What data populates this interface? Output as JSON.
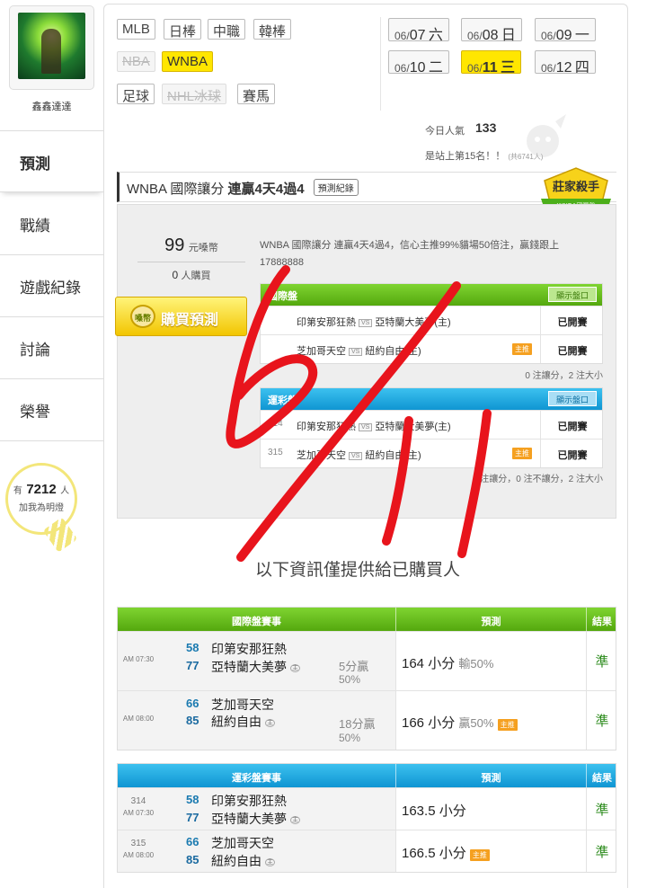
{
  "user": {
    "name": "鑫鑫達達"
  },
  "sidebar": {
    "tabs": [
      {
        "label": "預測",
        "active": true
      },
      {
        "label": "戰績"
      },
      {
        "label": "遊戲紀錄"
      },
      {
        "label": "討論"
      },
      {
        "label": "榮譽"
      }
    ],
    "fans": {
      "prefix": "有",
      "count": "7212",
      "suffix": "人",
      "sub": "加我為明燈"
    }
  },
  "leagues": [
    {
      "label": "MLB",
      "state": "normal"
    },
    {
      "label": "日棒",
      "state": "normal"
    },
    {
      "label": "中職",
      "state": "normal"
    },
    {
      "label": "韓棒",
      "state": "normal"
    },
    {
      "label": "NBA",
      "state": "disabled"
    },
    {
      "label": "WNBA",
      "state": "active"
    },
    {
      "label": "足球",
      "state": "normal"
    },
    {
      "label": "NHL冰球",
      "state": "disabled"
    },
    {
      "label": "賽馬",
      "state": "normal"
    }
  ],
  "dates": [
    {
      "prefix": "06/",
      "day": "07",
      "weekday": "六"
    },
    {
      "prefix": "06/",
      "day": "08",
      "weekday": "日"
    },
    {
      "prefix": "06/",
      "day": "09",
      "weekday": "一"
    },
    {
      "prefix": "06/",
      "day": "10",
      "weekday": "二"
    },
    {
      "prefix": "06/",
      "day": "11",
      "weekday": "三",
      "active": true
    },
    {
      "prefix": "06/",
      "day": "12",
      "weekday": "四"
    }
  ],
  "popularity": {
    "label": "今日人氣",
    "value": "133",
    "rank_text": "是站上第15名！！",
    "rank_total": "(共6741人)"
  },
  "prediction": {
    "title_prefix": "WNBA 國際讓分 ",
    "title_bold": "連贏4天4過4",
    "record_button": "預測紀錄",
    "badge_main": "莊家殺手",
    "badge_sub": "WNBA國際盤",
    "price": "99",
    "price_unit": "元嗓幣",
    "buyers": "0",
    "buyers_unit": "人購買",
    "buy_button": "購買預測",
    "buy_icon": "嗓幣",
    "description": "WNBA 國際讓分 連贏4天4過4，信心主推99%貓場50倍注，贏錢跟上17888888",
    "intl": {
      "header": "國際盤",
      "show_button": "顯示盤口",
      "rows": [
        {
          "no": "",
          "away": "印第安那狂熱",
          "home": "亞特蘭大美夢(主)",
          "tag": "",
          "status": "已開賽"
        },
        {
          "no": "",
          "away": "芝加哥天空",
          "home": "紐約自由(主)",
          "tag": "主推",
          "status": "已開賽"
        }
      ],
      "summary": "0 注讓分，2 注大小"
    },
    "lottery": {
      "header": "運彩盤",
      "show_button": "顯示盤口",
      "rows": [
        {
          "no": "314",
          "away": "印第安那狂熱",
          "home": "亞特蘭大美夢(主)",
          "tag": "",
          "status": "已開賽"
        },
        {
          "no": "315",
          "away": "芝加哥天空",
          "home": "紐約自由(主)",
          "tag": "主推",
          "status": "已開賽"
        }
      ],
      "summary": "0 注讓分，0 注不讓分，2 注大小"
    }
  },
  "info_title": "以下資訊僅提供給已購買人",
  "intl_results": {
    "headers": [
      "國際盤賽事",
      "預測",
      "結果"
    ],
    "rows": [
      {
        "no": "",
        "time": "AM 07:30",
        "away_no": "58",
        "away": "印第安那狂熱",
        "home_no": "77",
        "home": "亞特蘭大美夢",
        "home_mark": "主",
        "hcp": "5分贏",
        "hcp_pct": "50%",
        "pick": "164 小分",
        "pick_note": "輸50%",
        "tag": "",
        "result": "準"
      },
      {
        "no": "",
        "time": "AM 08:00",
        "away_no": "66",
        "away": "芝加哥天空",
        "home_no": "85",
        "home": "紐約自由",
        "home_mark": "主",
        "hcp": "18分贏",
        "hcp_pct": "50%",
        "pick": "166 小分",
        "pick_note": "贏50%",
        "tag": "主推",
        "result": "準"
      }
    ]
  },
  "lottery_results": {
    "headers": [
      "運彩盤賽事",
      "預測",
      "結果"
    ],
    "rows": [
      {
        "no": "314",
        "time": "AM 07:30",
        "away_no": "58",
        "away": "印第安那狂熱",
        "home_no": "77",
        "home": "亞特蘭大美夢",
        "home_mark": "主",
        "pick": "163.5 小分",
        "tag": "",
        "result": "準"
      },
      {
        "no": "315",
        "time": "AM 08:00",
        "away_no": "66",
        "away": "芝加哥天空",
        "home_no": "85",
        "home": "紐約自由",
        "home_mark": "主",
        "pick": "166.5 小分",
        "tag": "主推",
        "result": "準"
      }
    ]
  },
  "annotation": {
    "handwriting": "6/11",
    "color": "#e8141c"
  },
  "colors": {
    "active_yellow": "#ffe600",
    "green_header": "#5cb314",
    "blue_header": "#1aa3dd",
    "result_green": "#2a8a1a"
  }
}
